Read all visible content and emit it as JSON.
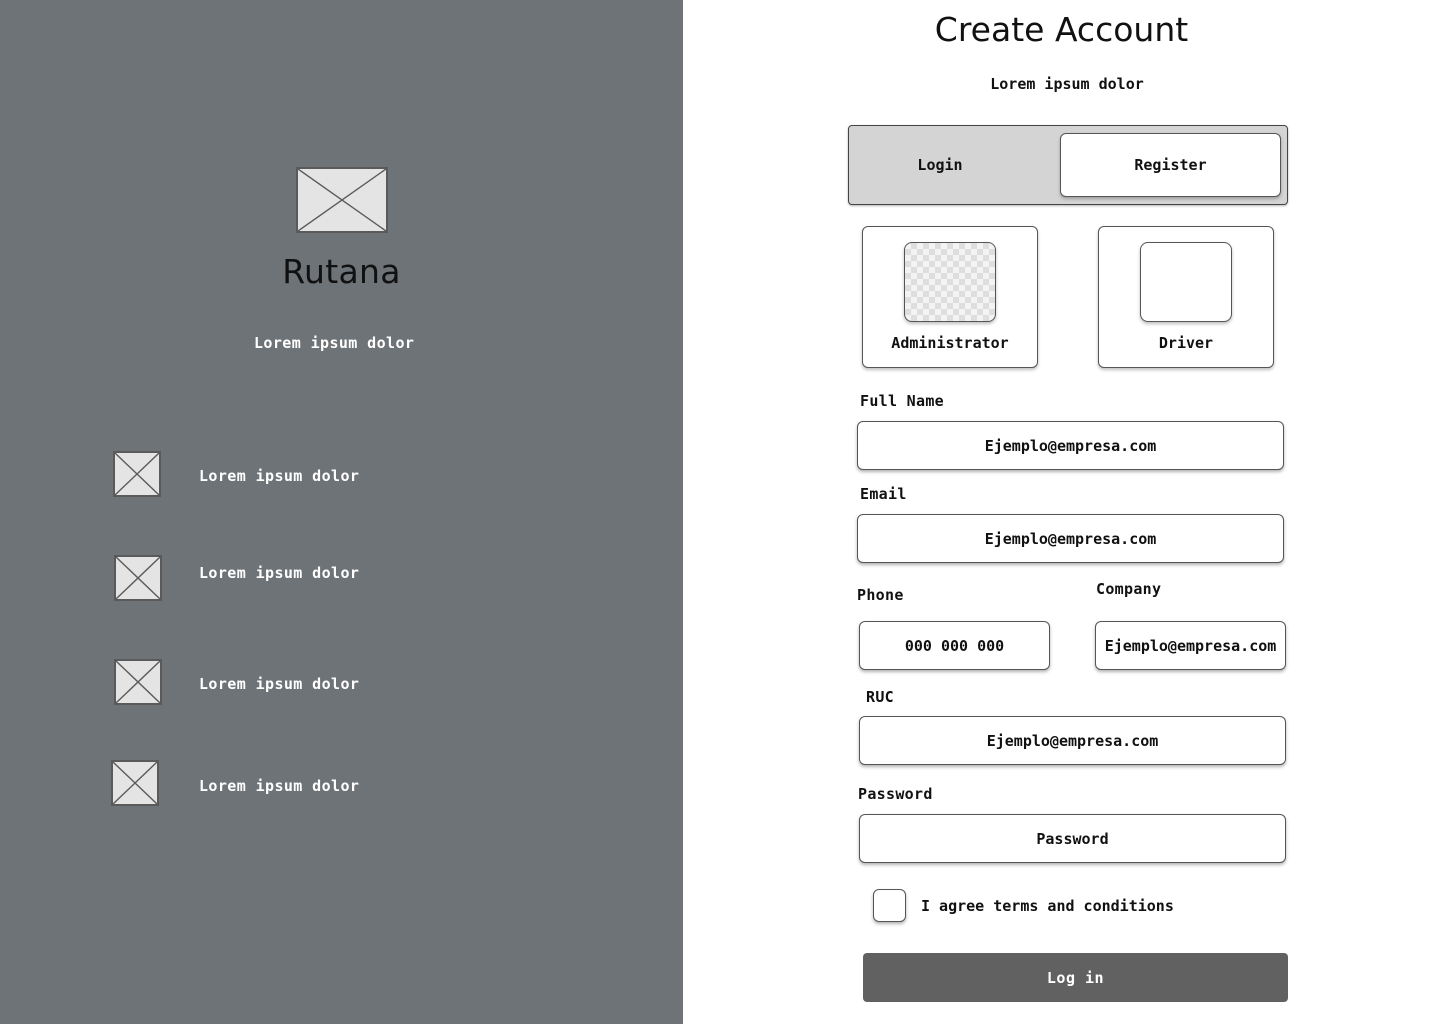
{
  "brand": {
    "name": "Rutana",
    "tagline": "Lorem ipsum dolor",
    "logo_icon": "image-placeholder-icon"
  },
  "features": [
    {
      "icon": "image-placeholder-icon",
      "text": "Lorem ipsum dolor"
    },
    {
      "icon": "image-placeholder-icon",
      "text": "Lorem ipsum dolor"
    },
    {
      "icon": "image-placeholder-icon",
      "text": "Lorem ipsum dolor"
    },
    {
      "icon": "image-placeholder-icon",
      "text": "Lorem ipsum dolor"
    }
  ],
  "form": {
    "title": "Create Account",
    "subtitle": "Lorem ipsum dolor",
    "tabs": {
      "login": "Login",
      "register": "Register",
      "active": "register"
    },
    "roles": [
      {
        "label": "Administrator",
        "icon": "image-placeholder-icon"
      },
      {
        "label": "Driver",
        "icon": "image-placeholder-icon"
      }
    ],
    "fields": {
      "full_name": {
        "label": "Full Name",
        "value": "Ejemplo@empresa.com"
      },
      "email": {
        "label": "Email",
        "value": "Ejemplo@empresa.com"
      },
      "phone": {
        "label": "Phone",
        "value": "000 000 000"
      },
      "company": {
        "label": "Company",
        "value": "Ejemplo@empresa.com"
      },
      "ruc": {
        "label": "RUC",
        "value": "Ejemplo@empresa.com"
      },
      "password": {
        "label": "Password",
        "value": "Password"
      }
    },
    "terms_label": "I agree terms and conditions",
    "terms_checked": false,
    "submit_label": "Log in"
  },
  "colors": {
    "left_panel": "#6e7377",
    "button": "#616161",
    "toggle_bg": "#d4d4d4"
  }
}
